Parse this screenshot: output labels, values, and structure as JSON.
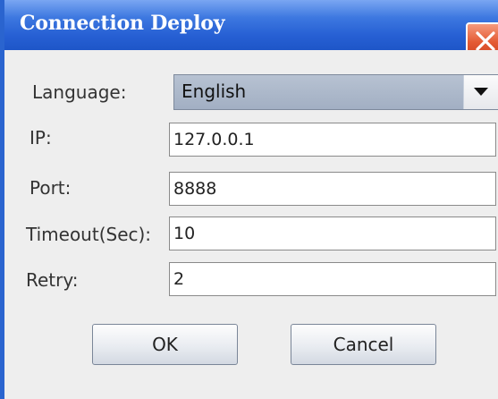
{
  "window": {
    "title": "Connection Deploy"
  },
  "form": {
    "language": {
      "label": "Language:",
      "value": "English"
    },
    "ip": {
      "label": "IP:",
      "value": "127.0.0.1"
    },
    "port": {
      "label": "Port:",
      "value": "8888"
    },
    "timeout": {
      "label": "Timeout(Sec):",
      "value": "10"
    },
    "retry": {
      "label": "Retry:",
      "value": "2"
    }
  },
  "buttons": {
    "ok": "OK",
    "cancel": "Cancel"
  },
  "colors": {
    "titlebar": "#2760d4",
    "close_button": "#e45a33",
    "dialog_background": "#eeeeee",
    "combo_selected": "#a2afc3"
  }
}
